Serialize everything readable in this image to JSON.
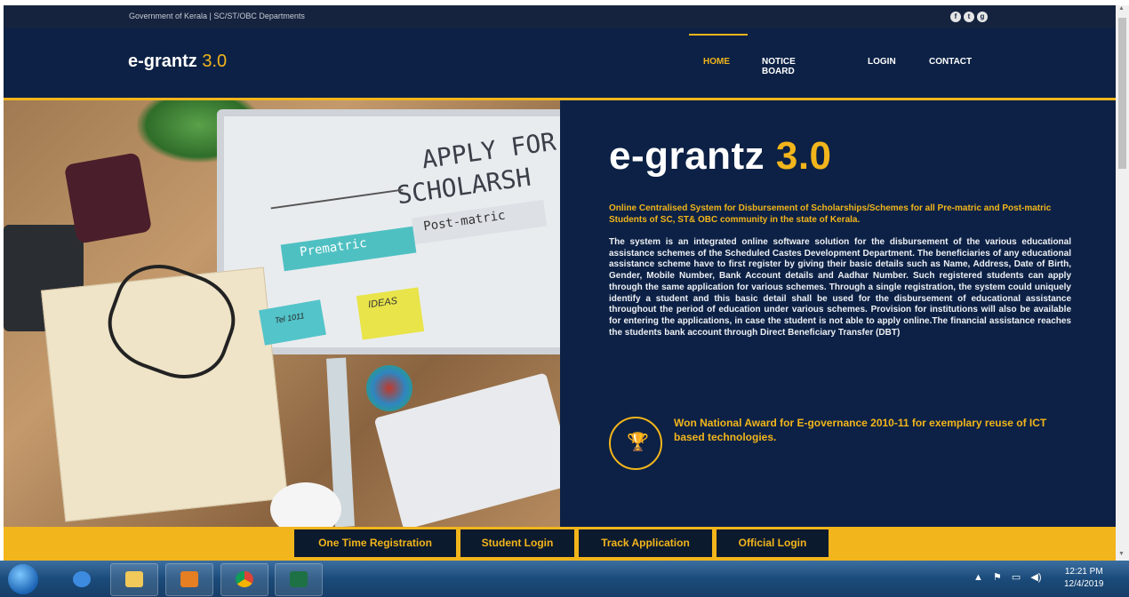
{
  "topbar": {
    "gov_text": "Government of Kerala | SC/ST/OBC Departments",
    "social": [
      "f",
      "t",
      "g"
    ]
  },
  "header": {
    "logo_main": "e-grantz",
    "logo_version": "3.0",
    "nav": [
      "HOME",
      "NOTICE BOARD",
      "LOGIN",
      "CONTACT"
    ],
    "active_nav": "HOME"
  },
  "hero": {
    "image_text": {
      "apply": "APPLY FOR",
      "scholarship": "SCHOLARSH",
      "postmatric": "Post-matric",
      "prematric": "Prematric",
      "ideas": "IDEAS",
      "note": "Tel 1011"
    },
    "title_main": "e-grantz",
    "title_version": "3.0",
    "tagline": "Online Centralised System for Disbursement of Scholarships/Schemes for all Pre-matric and Post-matric Students of SC, ST& OBC community in the state of Kerala.",
    "description": "The system is an integrated online software solution for the disbursement of the various educational assistance schemes of the Scheduled Castes Development Department. The beneficiaries of any educational assistance scheme have to first register by giving their basic details such as Name, Address, Date of Birth, Gender, Mobile Number, Bank Account details and Aadhar Number. Such registered students can apply through the same application for various schemes. Through a single registration, the system could uniquely identify a student and this basic detail shall be used for the disbursement of educational assistance throughout the period of education under various schemes. Provision for institutions will also be available for entering the applications, in case the student is not able to apply online.The financial assistance reaches the students bank account through Direct Beneficiary Transfer (DBT)",
    "award": "Won National Award for E-governance 2010-11 for exemplary reuse of ICT based technologies."
  },
  "buttons": [
    "One Time Registration",
    "Student Login",
    "Track Application",
    "Official Login"
  ],
  "taskbar": {
    "time": "12:21 PM",
    "date": "12/4/2019"
  },
  "colors": {
    "navy": "#0c2145",
    "gold": "#f2b51b"
  }
}
